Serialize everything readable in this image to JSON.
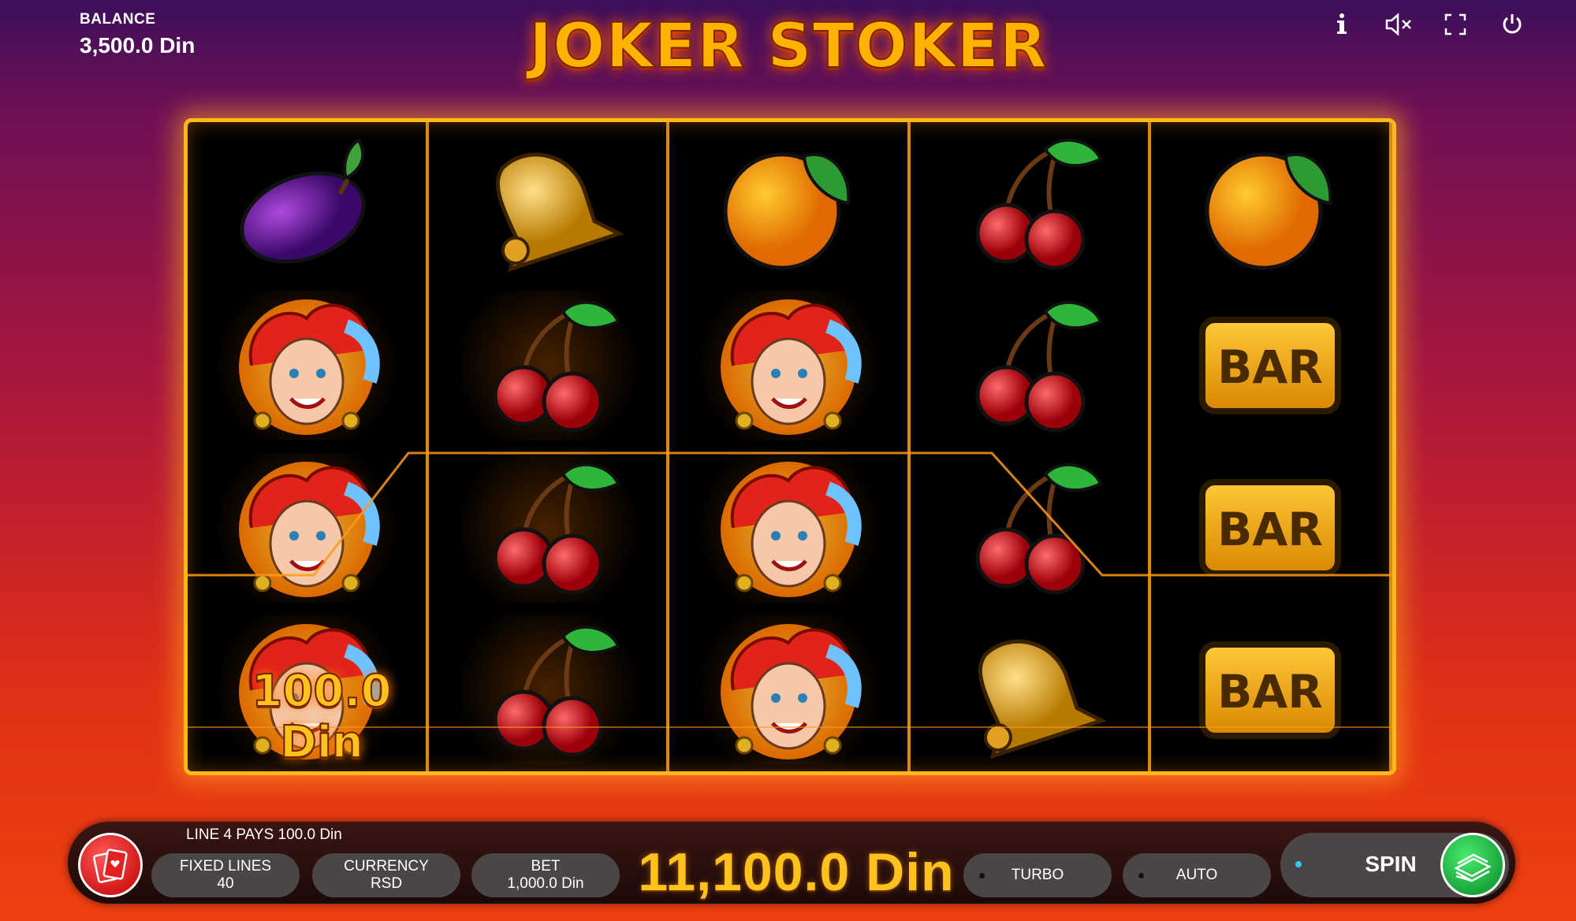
{
  "game": {
    "title": "JOKER STOKER",
    "balance_label": "BALANCE",
    "balance_value": "3,500.0 Din"
  },
  "top_icons": [
    "info-icon",
    "sound-muted-icon",
    "fullscreen-icon",
    "power-icon"
  ],
  "reels": [
    [
      "plum",
      "joker",
      "joker",
      "joker"
    ],
    [
      "bell",
      "cherry",
      "cherry",
      "cherry"
    ],
    [
      "orange",
      "joker",
      "joker",
      "joker"
    ],
    [
      "cherry",
      "cherry",
      "cherry",
      "bell"
    ],
    [
      "orange",
      "bar",
      "bar",
      "bar"
    ]
  ],
  "bar_label": "BAR",
  "win_amount": "100.0 Din",
  "status": {
    "line_pays": "LINE 4 PAYS 100.0 Din"
  },
  "controls": {
    "fixed_lines_label": "FIXED LINES",
    "fixed_lines_value": "40",
    "currency_label": "CURRENCY",
    "currency_value": "RSD",
    "bet_label": "BET",
    "bet_value": "1,000.0 Din",
    "total_win": "11,100.0 Din",
    "turbo_label": "TURBO",
    "auto_label": "AUTO",
    "spin_label": "SPIN"
  },
  "colors": {
    "frame": "#ffb81c",
    "win_text": "#ffc21c",
    "spin_button": "#18a53a",
    "rules_button": "#d21818"
  }
}
